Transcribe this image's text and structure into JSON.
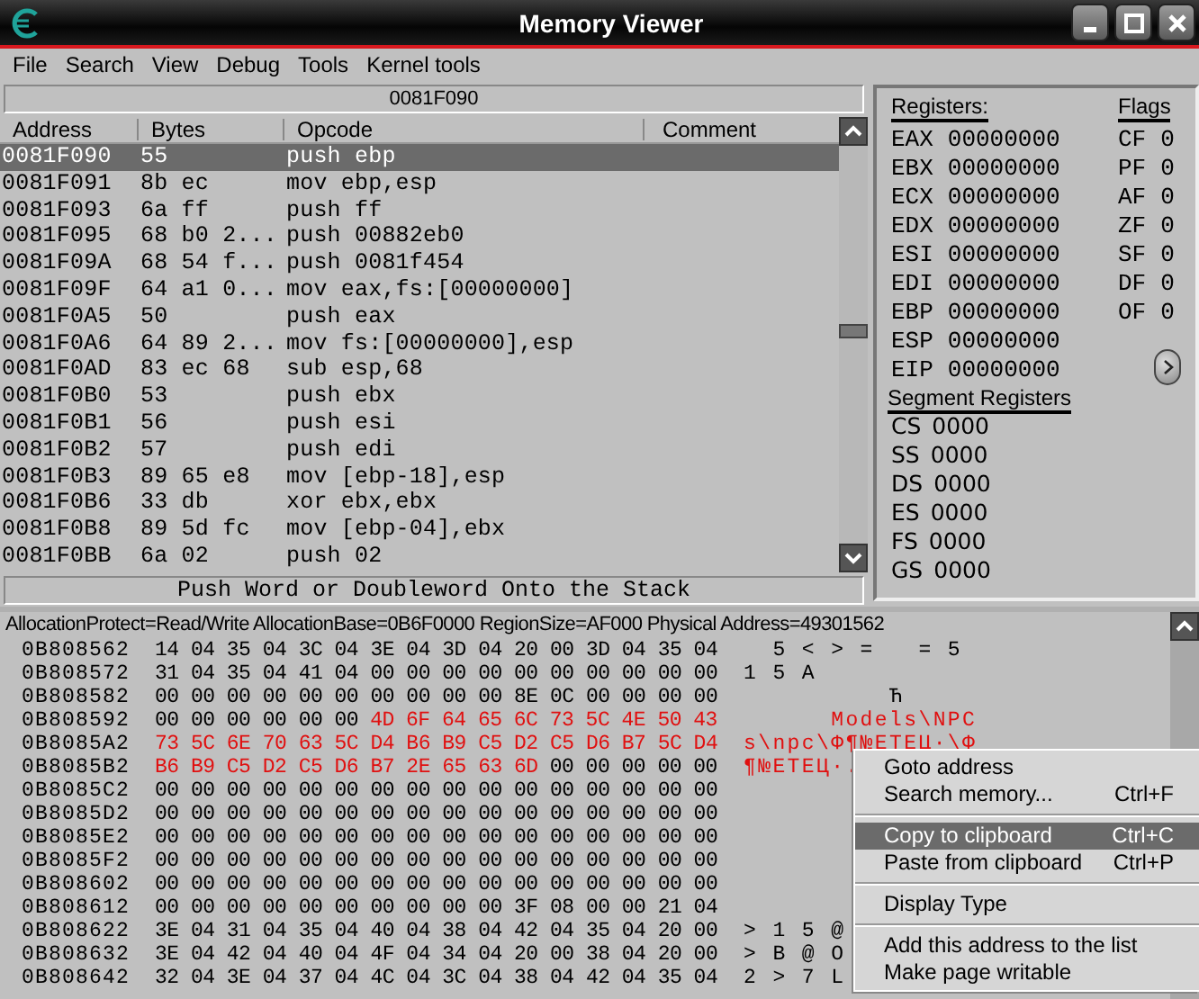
{
  "window": {
    "title": "Memory Viewer"
  },
  "menu": [
    "File",
    "Search",
    "View",
    "Debug",
    "Tools",
    "Kernel tools"
  ],
  "disassembler": {
    "address_bar": "0081F090",
    "columns": [
      "Address",
      "Bytes",
      "Opcode",
      "Comment"
    ],
    "rows": [
      {
        "address": "0081F090",
        "bytes": "55",
        "opcode": "push ebp",
        "selected": true
      },
      {
        "address": "0081F091",
        "bytes": "8b ec",
        "opcode": "mov ebp,esp",
        "selected": false
      },
      {
        "address": "0081F093",
        "bytes": "6a ff",
        "opcode": "push ff",
        "selected": false
      },
      {
        "address": "0081F095",
        "bytes": "68 b0 2...",
        "opcode": "push 00882eb0",
        "selected": false
      },
      {
        "address": "0081F09A",
        "bytes": "68 54 f...",
        "opcode": "push 0081f454",
        "selected": false
      },
      {
        "address": "0081F09F",
        "bytes": "64 a1 0...",
        "opcode": "mov eax,fs:[00000000]",
        "selected": false
      },
      {
        "address": "0081F0A5",
        "bytes": "50",
        "opcode": "push eax",
        "selected": false
      },
      {
        "address": "0081F0A6",
        "bytes": "64 89 2...",
        "opcode": "mov fs:[00000000],esp",
        "selected": false
      },
      {
        "address": "0081F0AD",
        "bytes": "83 ec 68",
        "opcode": "sub esp,68",
        "selected": false
      },
      {
        "address": "0081F0B0",
        "bytes": "53",
        "opcode": "push ebx",
        "selected": false
      },
      {
        "address": "0081F0B1",
        "bytes": "56",
        "opcode": "push esi",
        "selected": false
      },
      {
        "address": "0081F0B2",
        "bytes": "57",
        "opcode": "push edi",
        "selected": false
      },
      {
        "address": "0081F0B3",
        "bytes": "89 65 e8",
        "opcode": "mov [ebp-18],esp",
        "selected": false
      },
      {
        "address": "0081F0B6",
        "bytes": "33 db",
        "opcode": "xor ebx,ebx",
        "selected": false
      },
      {
        "address": "0081F0B8",
        "bytes": "89 5d fc",
        "opcode": "mov [ebp-04],ebx",
        "selected": false
      },
      {
        "address": "0081F0BB",
        "bytes": "6a 02",
        "opcode": "push 02",
        "selected": false
      }
    ],
    "status": "Push Word or Doubleword Onto the Stack"
  },
  "registers": {
    "title": "Registers:",
    "items": [
      {
        "name": "EAX",
        "value": "00000000"
      },
      {
        "name": "EBX",
        "value": "00000000"
      },
      {
        "name": "ECX",
        "value": "00000000"
      },
      {
        "name": "EDX",
        "value": "00000000"
      },
      {
        "name": "ESI",
        "value": "00000000"
      },
      {
        "name": "EDI",
        "value": "00000000"
      },
      {
        "name": "EBP",
        "value": "00000000"
      },
      {
        "name": "ESP",
        "value": "00000000"
      },
      {
        "name": "EIP",
        "value": "00000000"
      }
    ],
    "flags_title": "Flags",
    "flags": [
      {
        "name": "CF",
        "value": "0"
      },
      {
        "name": "PF",
        "value": "0"
      },
      {
        "name": "AF",
        "value": "0"
      },
      {
        "name": "ZF",
        "value": "0"
      },
      {
        "name": "SF",
        "value": "0"
      },
      {
        "name": "DF",
        "value": "0"
      },
      {
        "name": "OF",
        "value": "0"
      }
    ],
    "segment_title": "Segment Registers",
    "segments": [
      {
        "name": "CS",
        "value": "0000"
      },
      {
        "name": "SS",
        "value": "0000"
      },
      {
        "name": "DS",
        "value": "0000"
      },
      {
        "name": "ES",
        "value": "0000"
      },
      {
        "name": "FS",
        "value": "0000"
      },
      {
        "name": "GS",
        "value": "0000"
      }
    ]
  },
  "hex_view": {
    "info": "AllocationProtect=Read/Write  AllocationBase=0B6F0000 RegionSize=AF000 Physical Address=49301562",
    "rows": [
      {
        "address": "0B808562",
        "hex": [
          {
            "text": "14 04 35 04 3C 04 3E 04 3D 04 20 00 3D 04 35 04",
            "marked": false
          }
        ],
        "ascii": "  5 < > =   = 5",
        "ascii_marked": false
      },
      {
        "address": "0B808572",
        "hex": [
          {
            "text": "31 04 35 04 41 04 00 00 00 00 00 00 00 00 00 00",
            "marked": false
          }
        ],
        "ascii": "1 5 A",
        "ascii_marked": false
      },
      {
        "address": "0B808582",
        "hex": [
          {
            "text": "00 00 00 00 00 00 00 00 00 00 8E 0C 00 00 00 00",
            "marked": false
          }
        ],
        "ascii": "          Ћ",
        "ascii_marked": false
      },
      {
        "address": "0B808592",
        "hex": [
          {
            "text": "00 00 00 00 00 00",
            "marked": false
          },
          {
            "text": "4D 6F 64 65 6C 73 5C 4E 50 43",
            "marked": true
          }
        ],
        "ascii": "      Models\\NPC",
        "ascii_marked": true
      },
      {
        "address": "0B8085A2",
        "hex": [
          {
            "text": "73 5C 6E 70 63 5C D4 B6 B9 C5 D2 C5 D6 B7 5C D4",
            "marked": true
          }
        ],
        "ascii": "s\\npc\\Ф¶№ЕТЕЦ·\\Ф",
        "ascii_marked": true
      },
      {
        "address": "0B8085B2",
        "hex": [
          {
            "text": "B6 B9 C5 D2 C5 D6 B7 2E 65 63 6D",
            "marked": true
          },
          {
            "text": "00 00 00 00 00",
            "marked": false
          }
        ],
        "ascii": "¶№ЕТЕЦ·.",
        "ascii_marked": true
      },
      {
        "address": "0B8085C2",
        "hex": [
          {
            "text": "00 00 00 00 00 00 00 00 00 00 00 00 00 00 00 00",
            "marked": false
          }
        ]
      },
      {
        "address": "0B8085D2",
        "hex": [
          {
            "text": "00 00 00 00 00 00 00 00 00 00 00 00 00 00 00 00",
            "marked": false
          }
        ]
      },
      {
        "address": "0B8085E2",
        "hex": [
          {
            "text": "00 00 00 00 00 00 00 00 00 00 00 00 00 00 00 00",
            "marked": false
          }
        ]
      },
      {
        "address": "0B8085F2",
        "hex": [
          {
            "text": "00 00 00 00 00 00 00 00 00 00 00 00 00 00 00 00",
            "marked": false
          }
        ]
      },
      {
        "address": "0B808602",
        "hex": [
          {
            "text": "00 00 00 00 00 00 00 00 00 00 00 00 00 00 00 00",
            "marked": false
          }
        ]
      },
      {
        "address": "0B808612",
        "hex": [
          {
            "text": "00 00 00 00 00 00 00 00 00 00 3F 08 00 00 21 04",
            "marked": false
          }
        ]
      },
      {
        "address": "0B808622",
        "hex": [
          {
            "text": "3E 04 31 04 35 04 40 04 38 04 42 04 35 04 20 00",
            "marked": false
          }
        ],
        "ascii": "> 1 5 @",
        "ascii_marked": false
      },
      {
        "address": "0B808632",
        "hex": [
          {
            "text": "3E 04 42 04 40 04 4F 04 34 04 20 00 38 04 20 00",
            "marked": false
          }
        ],
        "ascii": "> B @ O",
        "ascii_marked": false
      },
      {
        "address": "0B808642",
        "hex": [
          {
            "text": "32 04 3E 04 37 04 4C 04 3C 04 38 04 42 04 35 04",
            "marked": false
          }
        ],
        "ascii": "2 > 7 L",
        "ascii_marked": false
      }
    ]
  },
  "context_menu": {
    "items": [
      {
        "kind": "item",
        "label": "Goto address",
        "selected": false
      },
      {
        "kind": "item",
        "label": "Search memory...",
        "shortcut": "Ctrl+F",
        "selected": false
      },
      {
        "kind": "separator"
      },
      {
        "kind": "item",
        "label": "Copy to clipboard",
        "shortcut": "Ctrl+C",
        "selected": true
      },
      {
        "kind": "item",
        "label": "Paste from clipboard",
        "shortcut": "Ctrl+P",
        "selected": false
      },
      {
        "kind": "separator"
      },
      {
        "kind": "item",
        "label": "Display Type",
        "selected": false
      },
      {
        "kind": "separator"
      },
      {
        "kind": "item",
        "label": "Add this address to the list",
        "selected": false
      },
      {
        "kind": "item",
        "label": "Make page writable",
        "selected": false
      }
    ]
  }
}
